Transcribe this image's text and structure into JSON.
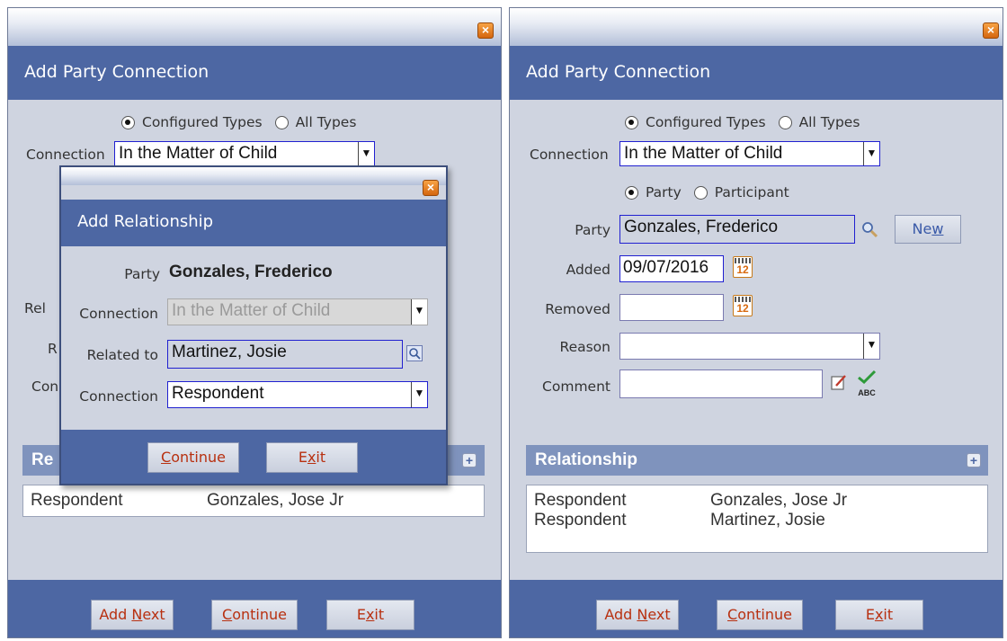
{
  "left": {
    "title": "Add Party Connection",
    "radio_configured": "Configured Types",
    "radio_all": "All Types",
    "connection_label": "Connection",
    "connection_value": "In the Matter of Child",
    "partial_labels": [
      "Rel",
      "R",
      "Con"
    ],
    "relationship_partial": "Re",
    "relationship_rows": [
      {
        "type": "Respondent",
        "name": "Gonzales, Jose Jr"
      }
    ],
    "buttons": {
      "add_next_pre": "Add ",
      "add_next_u": "N",
      "add_next_post": "ext",
      "continue_u": "C",
      "continue_post": "ontinue",
      "exit_pre": "E",
      "exit_u": "x",
      "exit_post": "it"
    }
  },
  "modal": {
    "title": "Add Relationship",
    "party_label": "Party",
    "party_value": "Gonzales, Frederico",
    "connection_label": "Connection",
    "connection_value": "In the Matter of Child",
    "related_label": "Related to",
    "related_value": "Martinez, Josie",
    "connection2_label": "Connection",
    "connection2_value": "Respondent",
    "buttons": {
      "continue_u": "C",
      "continue_post": "ontinue",
      "exit_pre": "E",
      "exit_u": "x",
      "exit_post": "it"
    }
  },
  "right": {
    "title": "Add Party Connection",
    "radio_configured": "Configured Types",
    "radio_all": "All Types",
    "connection_label": "Connection",
    "connection_value": "In the Matter of Child",
    "radio_party": "Party",
    "radio_participant": "Participant",
    "party_label": "Party",
    "party_value": "Gonzales, Frederico",
    "new_pre": "Ne",
    "new_u": "w",
    "added_label": "Added",
    "added_value": "09/07/2016",
    "removed_label": "Removed",
    "removed_value": "",
    "reason_label": "Reason",
    "reason_value": "",
    "comment_label": "Comment",
    "comment_value": "",
    "calendar_day": "12",
    "spell_label": "ABC",
    "relationship_header": "Relationship",
    "relationship_rows": [
      {
        "type": "Respondent",
        "name": "Gonzales, Jose Jr"
      },
      {
        "type": "Respondent",
        "name": "Martinez, Josie"
      }
    ],
    "buttons": {
      "add_next_pre": "Add ",
      "add_next_u": "N",
      "add_next_post": "ext",
      "continue_u": "C",
      "continue_post": "ontinue",
      "exit_pre": "E",
      "exit_u": "x",
      "exit_post": "it"
    }
  },
  "icons": {
    "close": "×",
    "plus": "+",
    "dropdown": "▼"
  },
  "colors": {
    "title_bar": "#4d67a3",
    "window_bg": "#cfd4e0",
    "section_bar": "#7f93bd",
    "button_text": "#b83010",
    "close_button": "#e07a1f"
  }
}
